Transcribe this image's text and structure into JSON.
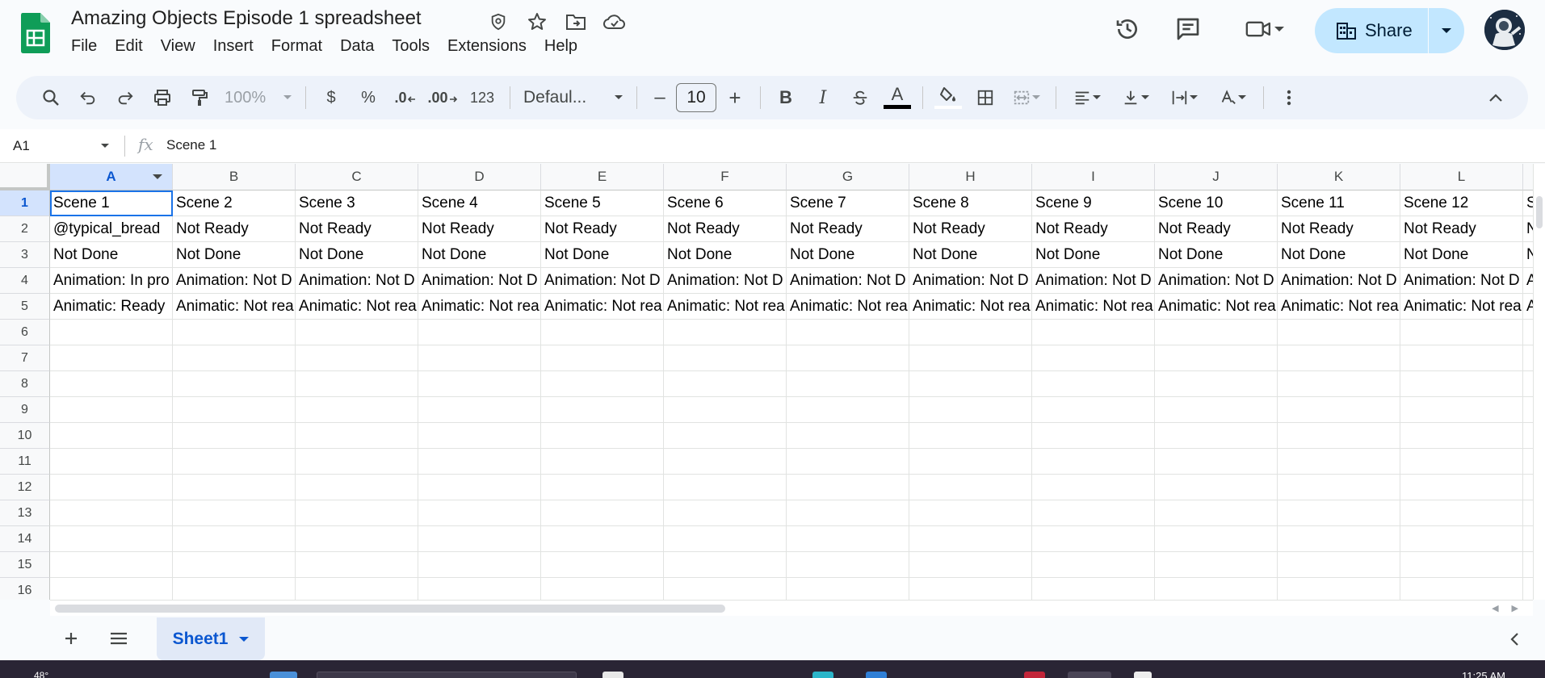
{
  "doc": {
    "title": "Amazing Objects Episode 1 spreadsheet"
  },
  "menu": [
    "File",
    "Edit",
    "View",
    "Insert",
    "Format",
    "Data",
    "Tools",
    "Extensions",
    "Help"
  ],
  "share": {
    "label": "Share"
  },
  "toolbar": {
    "zoom": "100%",
    "currency": "$",
    "percent": "%",
    "dec_decrease": ".0",
    "dec_increase": ".00",
    "number_format": "123",
    "font": "Defaul...",
    "minus": "–",
    "font_size": "10",
    "plus": "+",
    "bold": "B",
    "italic": "I",
    "text_color": "A"
  },
  "formula_bar": {
    "cell_ref": "A1",
    "fx": "fx",
    "value": "Scene 1"
  },
  "grid": {
    "columns": [
      "A",
      "B",
      "C",
      "D",
      "E",
      "F",
      "G",
      "H",
      "I",
      "J",
      "K",
      "L"
    ],
    "rows": [
      "1",
      "2",
      "3",
      "4",
      "5",
      "6",
      "7",
      "8",
      "9",
      "10",
      "11",
      "12",
      "13",
      "14",
      "15",
      "16"
    ],
    "cells": [
      [
        "Scene 1",
        "Scene 2",
        "Scene 3",
        "Scene 4",
        "Scene 5",
        "Scene 6",
        "Scene 7",
        "Scene 8",
        "Scene 9",
        "Scene 10",
        "Scene 11",
        "Scene 12",
        "S"
      ],
      [
        "@typical_bread",
        "Not Ready",
        "Not Ready",
        "Not Ready",
        "Not Ready",
        "Not Ready",
        "Not Ready",
        "Not Ready",
        "Not Ready",
        "Not Ready",
        "Not Ready",
        "Not Ready",
        "N"
      ],
      [
        "Not Done",
        "Not Done",
        "Not Done",
        "Not Done",
        "Not Done",
        "Not Done",
        "Not Done",
        "Not Done",
        "Not Done",
        "Not Done",
        "Not Done",
        "Not Done",
        "N"
      ],
      [
        "Animation: In pro",
        "Animation: Not D",
        "Animation: Not D",
        "Animation: Not D",
        "Animation: Not D",
        "Animation: Not D",
        "Animation: Not D",
        "Animation: Not D",
        "Animation: Not D",
        "Animation: Not D",
        "Animation: Not D",
        "Animation: Not D",
        "A"
      ],
      [
        "Animatic: Ready",
        "Animatic: Not rea",
        "Animatic: Not rea",
        "Animatic: Not rea",
        "Animatic: Not rea",
        "Animatic: Not rea",
        "Animatic: Not rea",
        "Animatic: Not rea",
        "Animatic: Not rea",
        "Animatic: Not rea",
        "Animatic: Not rea",
        "Animatic: Not rea",
        "A"
      ]
    ]
  },
  "sheets": [
    {
      "name": "Sheet1"
    }
  ],
  "taskbar": {
    "temp": "48°",
    "time": "11:25 AM"
  },
  "colors": {
    "accent": "#0b57d0",
    "share_bg": "#c2e7ff",
    "selection": "#1a73e8",
    "header_selected": "#d3e3fd",
    "sheets_green": "#0f9d58"
  }
}
